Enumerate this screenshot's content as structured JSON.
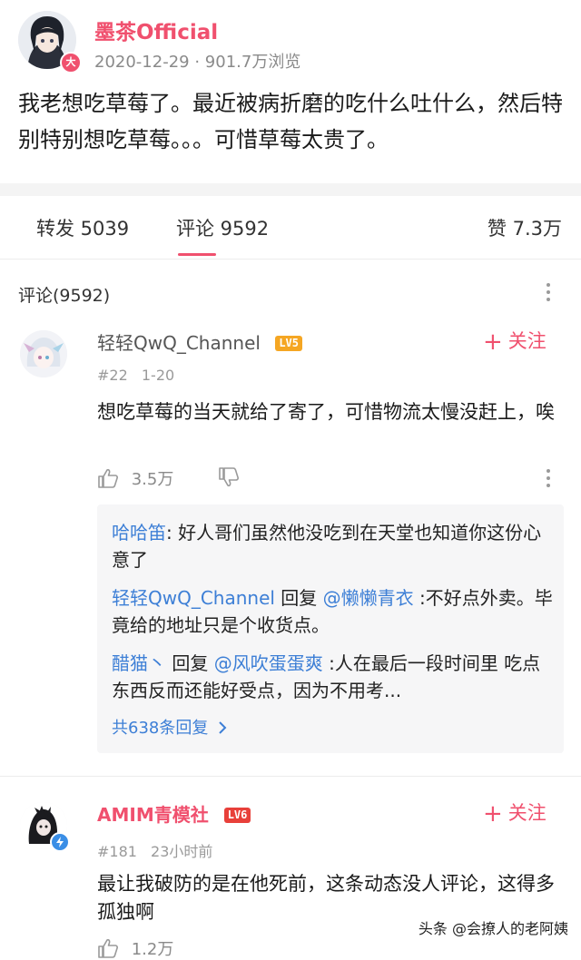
{
  "post": {
    "author": "墨茶Official",
    "badge": "大",
    "date": "2020-12-29",
    "views": "901.7万浏览",
    "text": "我老想吃草莓了。最近被病折磨的吃什么吐什么，然后特别特别想吃草莓。。。可惜草莓太贵了。"
  },
  "tabs": {
    "repost": "转发 5039",
    "comment": "评论 9592",
    "like": "赞 7.3万"
  },
  "comments_section": {
    "title": "评论(9592)"
  },
  "comments": [
    {
      "user": "轻轻QwQ_Channel",
      "level": "LV5",
      "follow": "关注",
      "floor": "#22",
      "date": "1-20",
      "text": "想吃草莓的当天就给了寄了，可惜物流太慢没赶上，唉",
      "likes": "3.5万",
      "replies": [
        {
          "user": "哈哈笛",
          "sep": ":",
          "text": " 好人哥们虽然他没吃到在天堂也知道你这份心意了"
        },
        {
          "user": "轻轻QwQ_Channel",
          "reply_word": " 回复 ",
          "target": "@懒懒青衣",
          "text": " :不好点外卖。毕竟给的地址只是个收货点。"
        },
        {
          "user": "醋猫丶",
          "reply_word": " 回复 ",
          "target": "@风吹蛋蛋爽",
          "text": " :人在最后一段时间里 吃点东西反而还能好受点，因为不用考..."
        }
      ],
      "more_replies": "共638条回复"
    },
    {
      "user": "AMIM青模社",
      "level": "LV6",
      "follow": "关注",
      "floor": "#181",
      "date": "23小时前",
      "text": "最让我破防的是在他死前，这条动态没人评论，这得多孤独啊",
      "likes": "1.2万"
    }
  ],
  "watermark": "头条 @会撩人的老阿姨",
  "colors": {
    "accent": "#f0506e",
    "link": "#3d7fd6"
  }
}
